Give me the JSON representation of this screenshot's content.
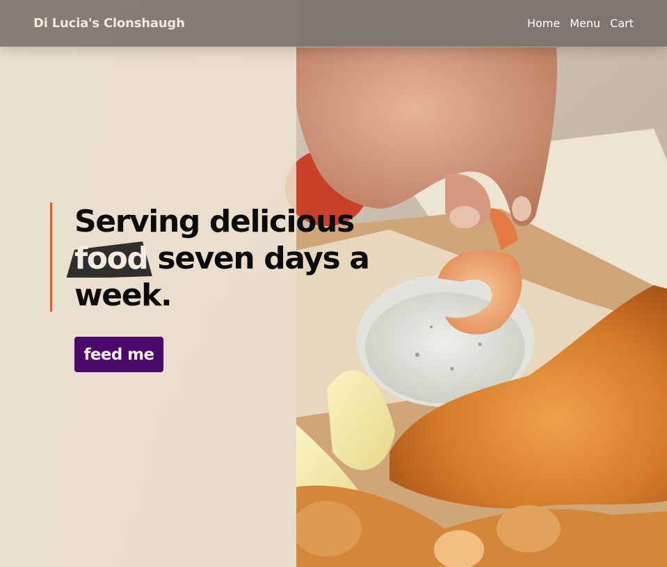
{
  "nav": {
    "brand": "Di Lucia's Clonshaugh",
    "links": [
      {
        "label": "Home"
      },
      {
        "label": "Menu"
      },
      {
        "label": "Cart"
      }
    ]
  },
  "hero": {
    "headline_start": "Serving delicious",
    "headline_highlight": "food",
    "headline_mid": "seven days a",
    "headline_end": "week.",
    "cta_label": "feed me",
    "background_image": "fish-and-chips-with-prawn-photo"
  },
  "colors": {
    "accent_border": "#f2541b",
    "cta_background": "#4a0a6b",
    "nav_background": "#6e6862",
    "highlight_background": "#2f2f2f",
    "page_background": "#e9dfcf"
  }
}
